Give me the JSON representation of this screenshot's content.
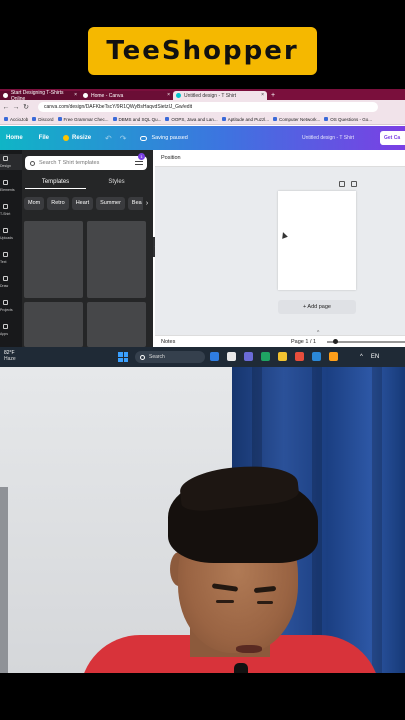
{
  "banner": {
    "title": "TeeShopper"
  },
  "browser": {
    "tabs": [
      {
        "label": "Start Designing T-Shirts Online"
      },
      {
        "label": "Home - Canva"
      },
      {
        "label": "Untitled design - T Shirt"
      }
    ],
    "new_tab": "+",
    "url": "canva.com/design/DAFKbeTscY/9R1QWyBsHaqvdSietzIJ_Gw/edit",
    "bookmarks": [
      "AccioJob",
      "Discord",
      "Free Grammar Chec...",
      "DBMS and SQL Qu...",
      "OOPS, Java and Lan...",
      "Aptitude and Puzzl...",
      "Computer Network...",
      "OS Questions - Go..."
    ]
  },
  "canva": {
    "home": "Home",
    "file": "File",
    "resize": "Resize",
    "saving": "Saving paused",
    "doc_title": "Untitled design - T Shirt",
    "get_canva": "Get Ca",
    "rail": [
      "Design",
      "Elements",
      "T-Shirt",
      "Uploads",
      "Text",
      "Draw",
      "Projects",
      "Apps"
    ],
    "search_placeholder": "Search T Shirt templates",
    "filter_badge": "1",
    "panel_tabs": [
      "Templates",
      "Styles"
    ],
    "chips": [
      "Mom",
      "Retro",
      "Heart",
      "Summer",
      "Bea"
    ],
    "context_label": "Position",
    "add_page": "+ Add page",
    "notes": "Notes",
    "page_indicator": "Page 1 / 1"
  },
  "taskbar": {
    "temp": "82°F",
    "condition": "Haze",
    "search_placeholder": "Search",
    "lang": "EN"
  }
}
